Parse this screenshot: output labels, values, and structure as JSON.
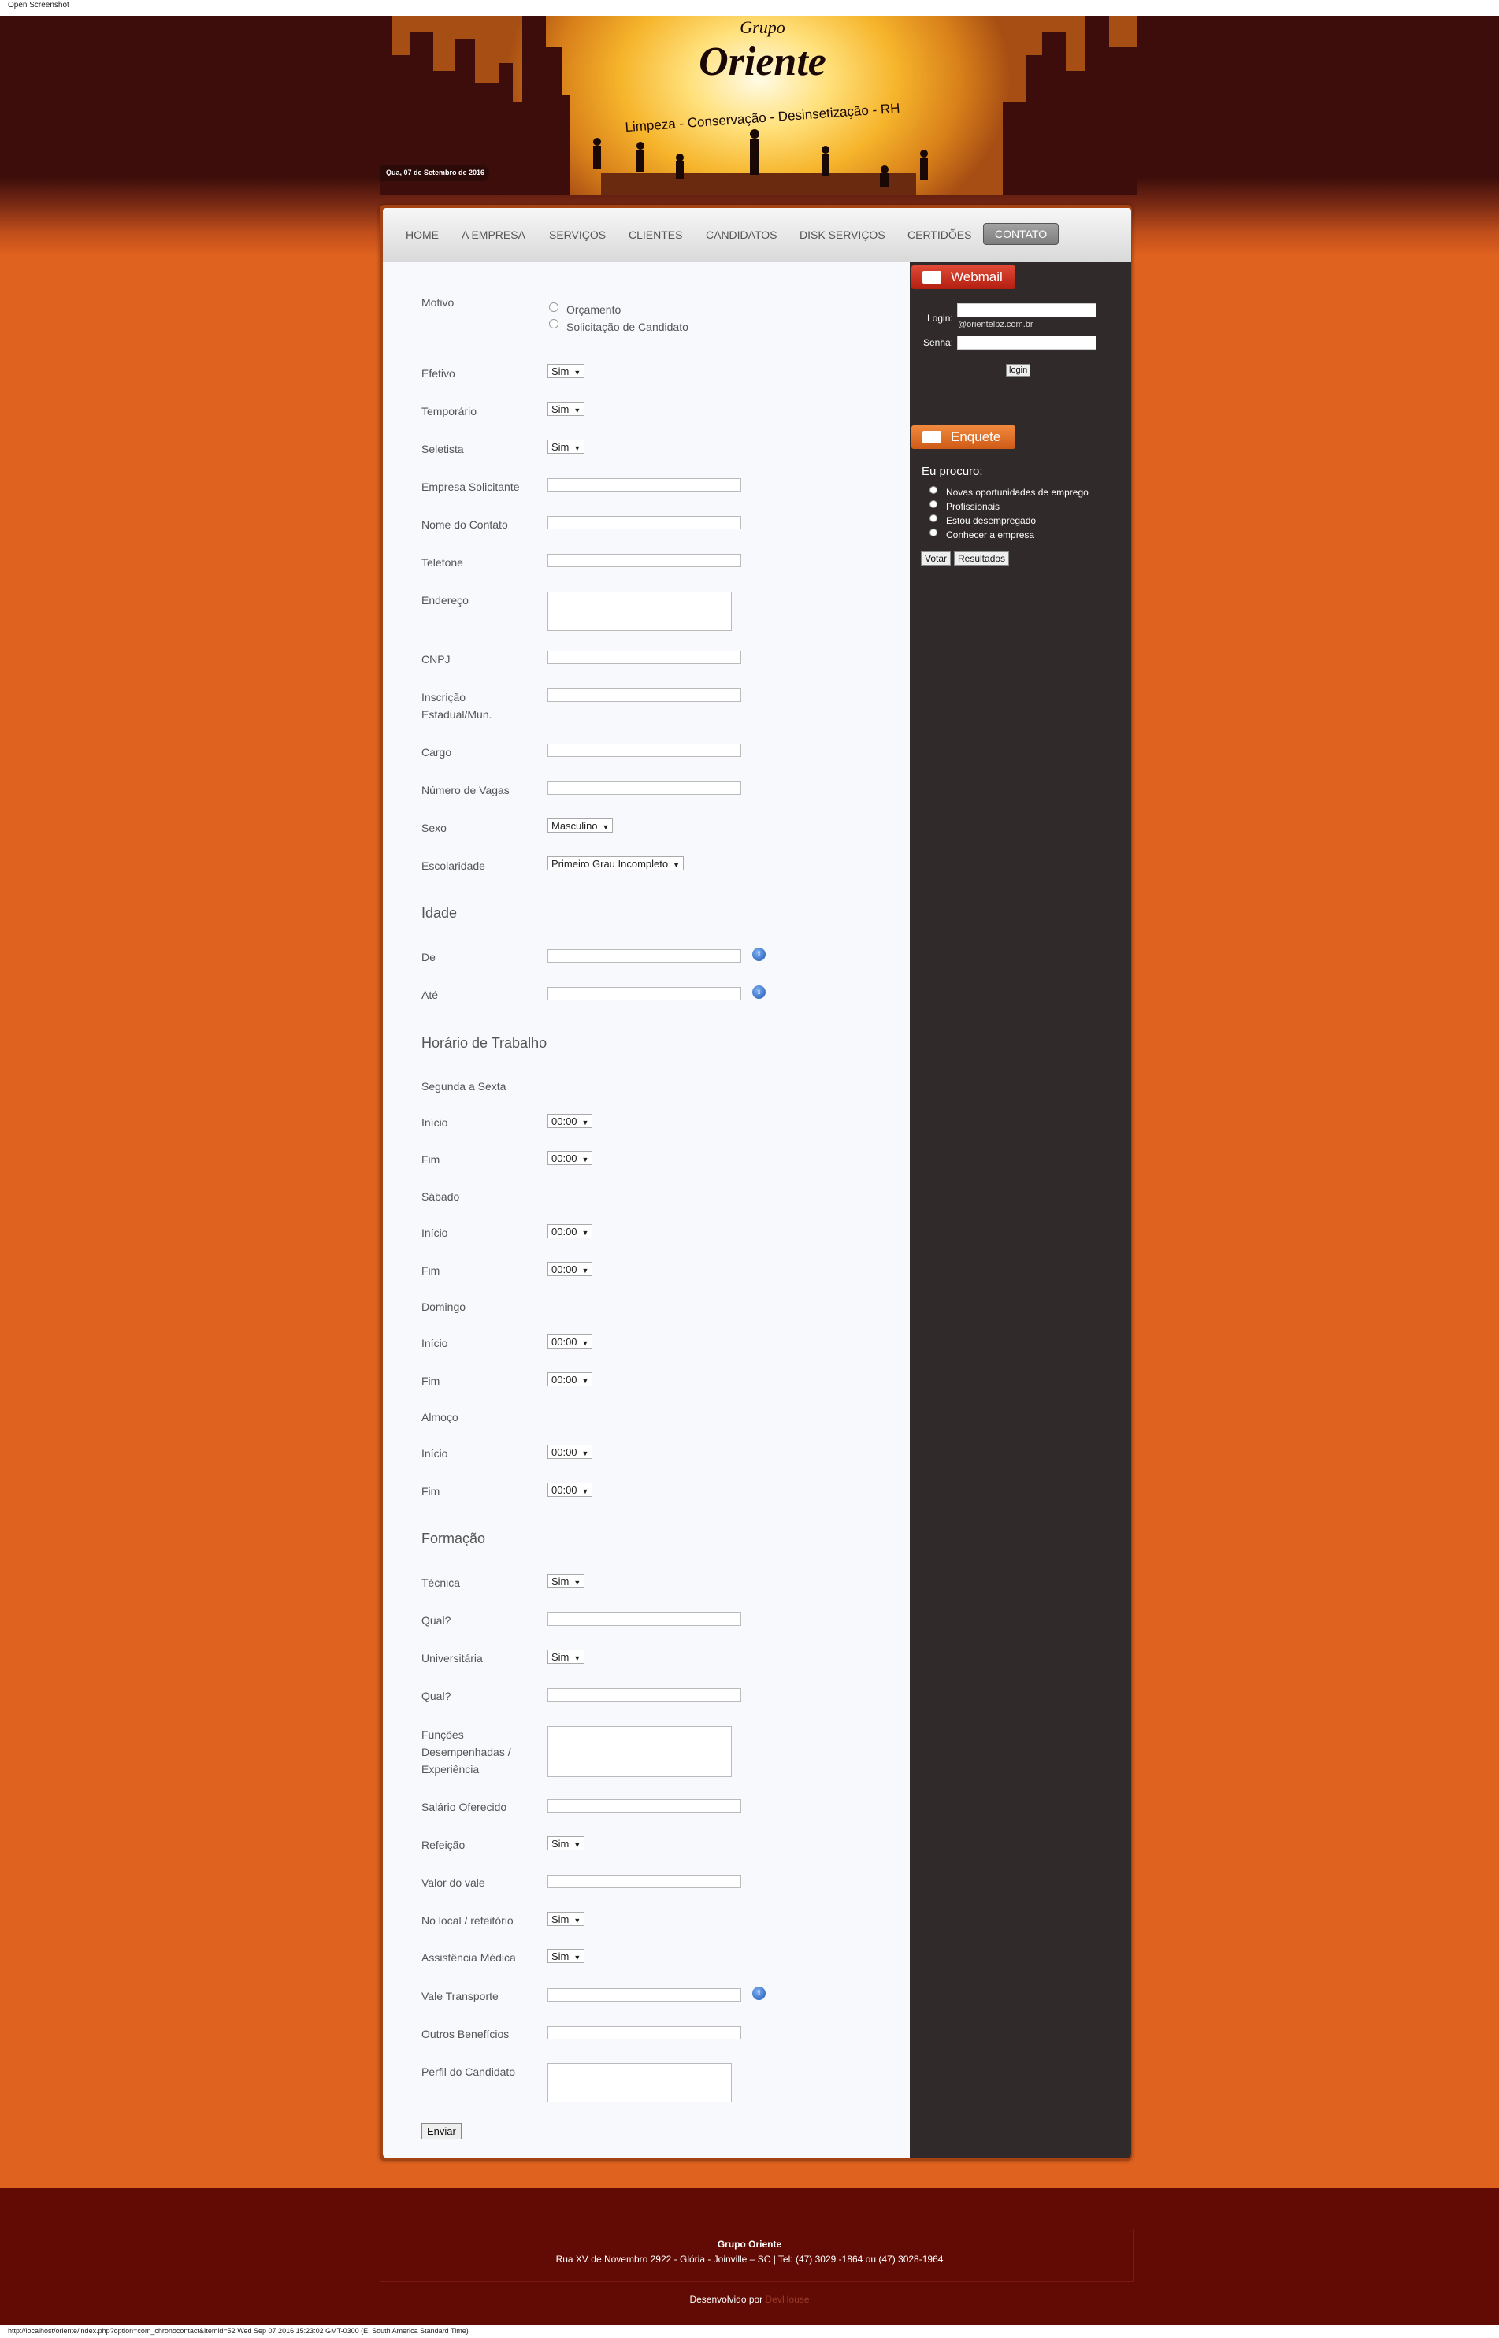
{
  "topbar": {
    "text": "Open Screenshot"
  },
  "header": {
    "brand_small": "Grupo",
    "brand_big": "Oriente",
    "tagline": "Limpeza - Conservação - Desinsetização - RH",
    "date": "Qua, 07 de Setembro de 2016"
  },
  "nav": {
    "items": [
      "HOME",
      "A EMPRESA",
      "SERVIÇOS",
      "CLIENTES",
      "CANDIDATOS",
      "DISK SERVIÇOS",
      "CERTIDÕES",
      "CONTATO"
    ],
    "active": "CONTATO"
  },
  "form": {
    "motivo": {
      "label": "Motivo",
      "options": [
        "Orçamento",
        "Solicitação de Candidato"
      ]
    },
    "efetivo": {
      "label": "Efetivo",
      "value": "Sim"
    },
    "temporario": {
      "label": "Temporário",
      "value": "Sim"
    },
    "seletista": {
      "label": "Seletista",
      "value": "Sim"
    },
    "empresa": {
      "label": "Empresa Solicitante"
    },
    "contato": {
      "label": "Nome do Contato"
    },
    "telefone": {
      "label": "Telefone"
    },
    "endereco": {
      "label": "Endereço"
    },
    "cnpj": {
      "label": "CNPJ"
    },
    "inscricao": {
      "label_1": "Inscrição",
      "label_2": "Estadual/Mun."
    },
    "cargo": {
      "label": "Cargo"
    },
    "vagas": {
      "label": "Número de Vagas"
    },
    "sexo": {
      "label": "Sexo",
      "value": "Masculino"
    },
    "escolaridade": {
      "label": "Escolaridade",
      "value": "Primeiro Grau Incompleto"
    },
    "idade": {
      "title": "Idade",
      "de": "De",
      "ate": "Até"
    },
    "horario": {
      "title": "Horário de Trabalho",
      "groups": [
        "Segunda a Sexta",
        "Sábado",
        "Domingo",
        "Almoço"
      ],
      "inicio": "Início",
      "fim": "Fim",
      "time_value": "00:00"
    },
    "formacao": {
      "title": "Formação",
      "tecnica": "Técnica",
      "tecnica_value": "Sim",
      "qual": "Qual?",
      "universitaria": "Universitária",
      "universitaria_value": "Sim",
      "funcoes_1": "Funções",
      "funcoes_2": "Desempenhadas /",
      "funcoes_3": "Experiência",
      "salario": "Salário Oferecido",
      "refeicao": "Refeição",
      "refeicao_value": "Sim",
      "valor_vale": "Valor do vale",
      "local": "No local / refeitório",
      "local_value": "Sim",
      "assistencia": "Assistência Médica",
      "assistencia_value": "Sim",
      "vale_transporte": "Vale Transporte",
      "outros": "Outros Benefícios",
      "perfil": "Perfil do Candidato"
    },
    "submit": "Enviar"
  },
  "sidebar": {
    "webmail": {
      "title": "Webmail",
      "login_label": "Login:",
      "domain": "@orientelpz.com.br",
      "senha_label": "Senha:",
      "login_button": "login"
    },
    "enquete": {
      "title": "Enquete",
      "question": "Eu procuro:",
      "options": [
        "Novas oportunidades de emprego",
        "Profissionais",
        "Estou desempregado",
        "Conhecer a empresa"
      ],
      "vote_button": "Votar",
      "results_button": "Resultados"
    }
  },
  "footer": {
    "company": "Grupo Oriente",
    "address": "Rua XV de Novembro 2922 - Glória - Joinville – SC | Tel: (47) 3029 -1864 ou (47) 3028-1964",
    "dev_prefix": "Desenvolvido por",
    "dev_name": "DevHouse"
  },
  "statusbar": "http://localhost/oriente/index.php?option=com_chronocontact&Itemid=52 Wed Sep 07 2016 15:23:02 GMT-0300 (E. South America Standard Time)",
  "colors": {
    "page_bg": "#e0621f",
    "header_dark": "#3c0d0a",
    "footer_bg": "#620b04",
    "sidebar_bg": "#302b2a",
    "webmail_tab": "#c22a1a",
    "enquete_tab": "#e06a22"
  }
}
